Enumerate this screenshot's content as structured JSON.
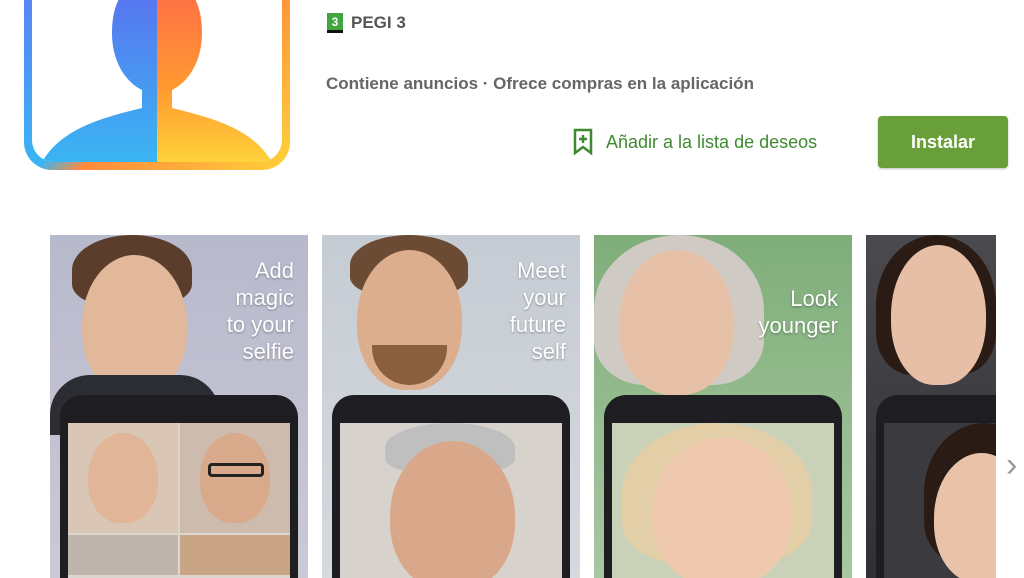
{
  "app": {
    "rating_badge": "3",
    "rating_label": "PEGI 3",
    "meta": "Contiene anuncios · Ofrece compras en la aplicación",
    "wishlist_label": "Añadir a la lista de deseos",
    "install_label": "Instalar"
  },
  "colors": {
    "accent": "#689f38",
    "wishlist": "#3f8a30"
  },
  "screenshots": [
    {
      "caption": "Add\nmagic\nto your\nselfie"
    },
    {
      "caption": "Meet\nyour\nfuture\nself"
    },
    {
      "caption": "Look\nyounger"
    },
    {
      "caption": ""
    }
  ],
  "icons": [
    "bookmark-plus-icon",
    "chevron-right-icon"
  ]
}
